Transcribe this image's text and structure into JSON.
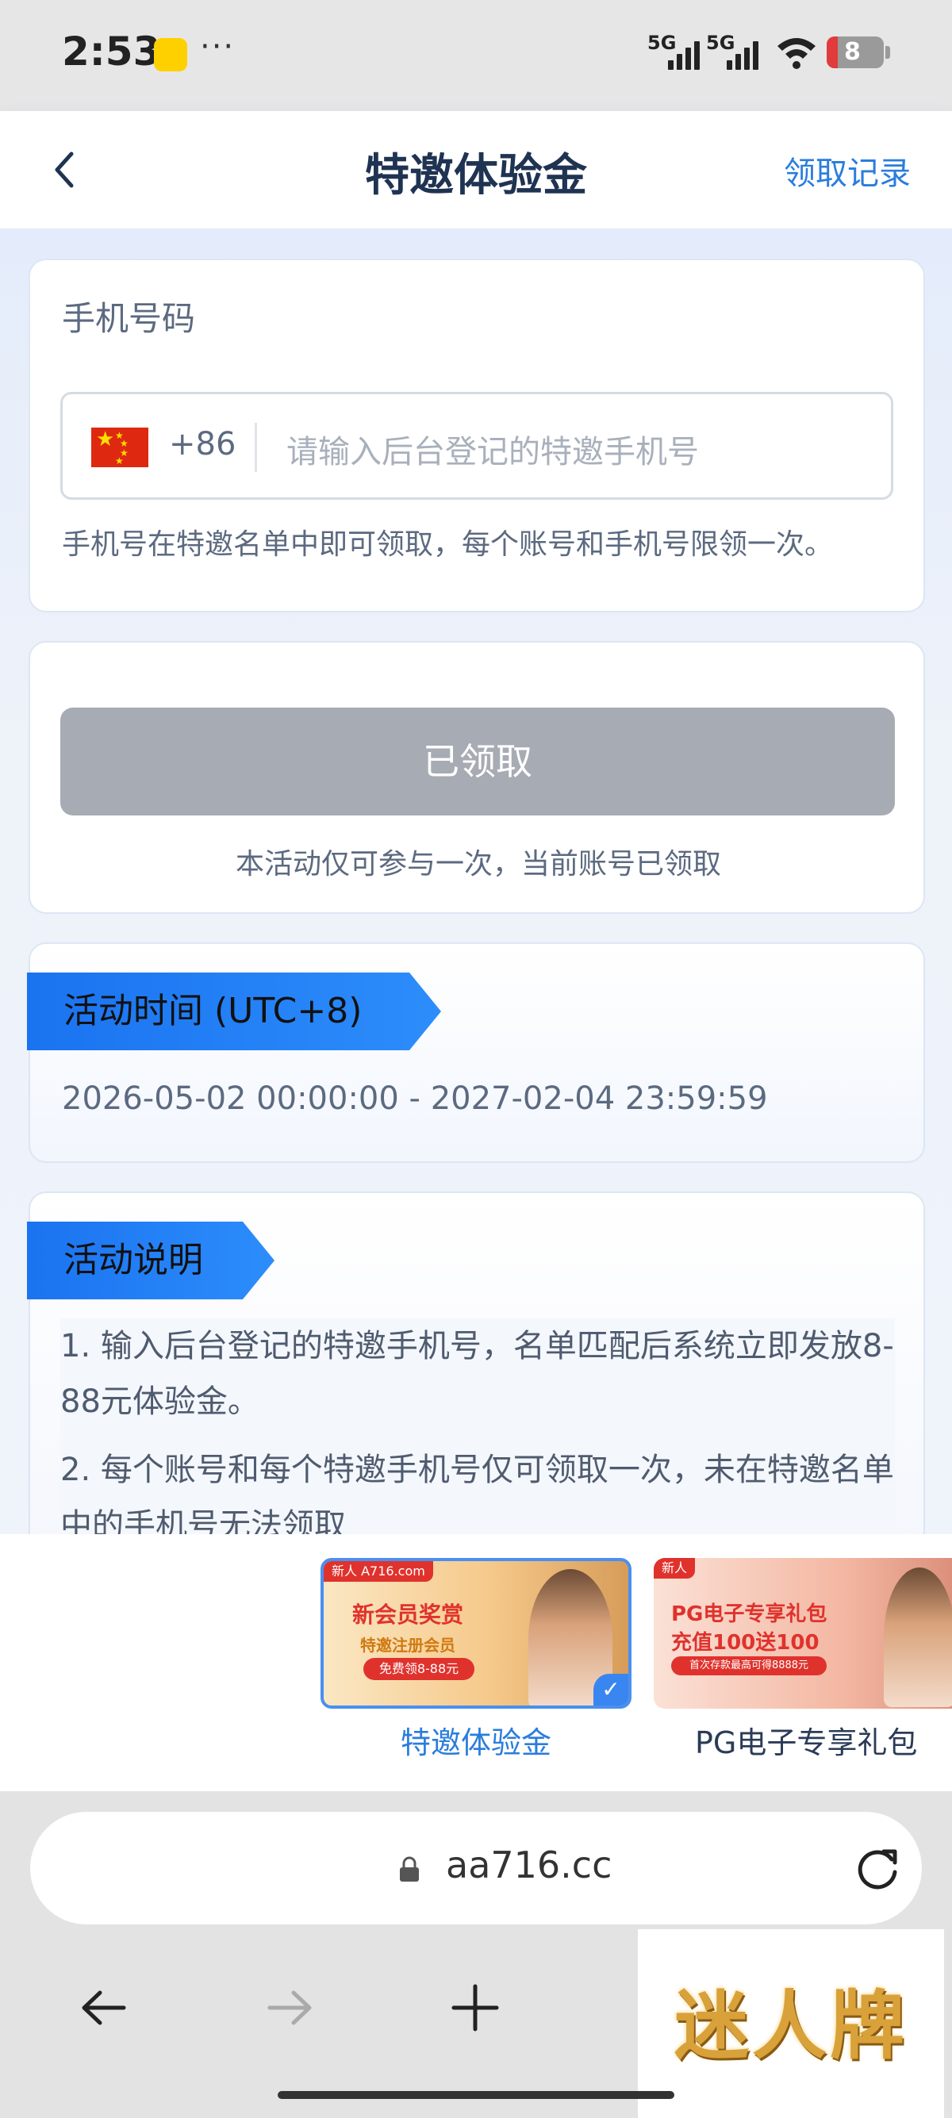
{
  "status_bar": {
    "time": "2:53",
    "dots": "···",
    "network_1": "5G",
    "network_2": "5G",
    "battery": "8"
  },
  "app_bar": {
    "title": "特邀体验金",
    "right_link": "领取记录"
  },
  "phone_card": {
    "label": "手机号码",
    "country_code": "+86",
    "placeholder": "请输入后台登记的特邀手机号",
    "hint": "手机号在特邀名单中即可领取，每个账号和手机号限领一次。"
  },
  "claim_card": {
    "button_label": "已领取",
    "note": "本活动仅可参与一次，当前账号已领取"
  },
  "time_card": {
    "heading": "活动时间 (UTC+8)",
    "range": "2026-05-02 00:00:00 - 2027-02-04 23:59:59"
  },
  "desc_card": {
    "heading": "活动说明",
    "items": [
      "1. 输入后台登记的特邀手机号，名单匹配后系统立即发放8-88元体验金。",
      "2. 每个账号和每个特邀手机号仅可领取一次，未在特邀名单中的手机号无法领取"
    ]
  },
  "bottom_tabs": [
    {
      "label": "特邀体验金",
      "banner_tag": "新人 A716.com",
      "banner_title": "新会员奖赏",
      "banner_sub": "特邀注册会员",
      "banner_pill": "免费领8-88元",
      "selected": true
    },
    {
      "label": "PG电子专享礼包",
      "banner_tag": "新人",
      "banner_title": "PG电子专享礼包",
      "banner_sub": "充值100送100",
      "banner_pill": "首次存款最高可得8888元",
      "selected": false
    }
  ],
  "browser": {
    "url": "aa716.cc",
    "logo_text": "迷人牌"
  },
  "colors": {
    "accent": "#2a7ddd",
    "ribbon": "#1a73f0",
    "disabled_button": "#a7abb3",
    "title": "#1f3352"
  },
  "icons": [
    "back-arrow-icon",
    "lock-icon",
    "reload-icon",
    "nav-back-icon",
    "nav-forward-icon",
    "new-tab-plus-icon",
    "check-icon",
    "china-flag-icon"
  ]
}
